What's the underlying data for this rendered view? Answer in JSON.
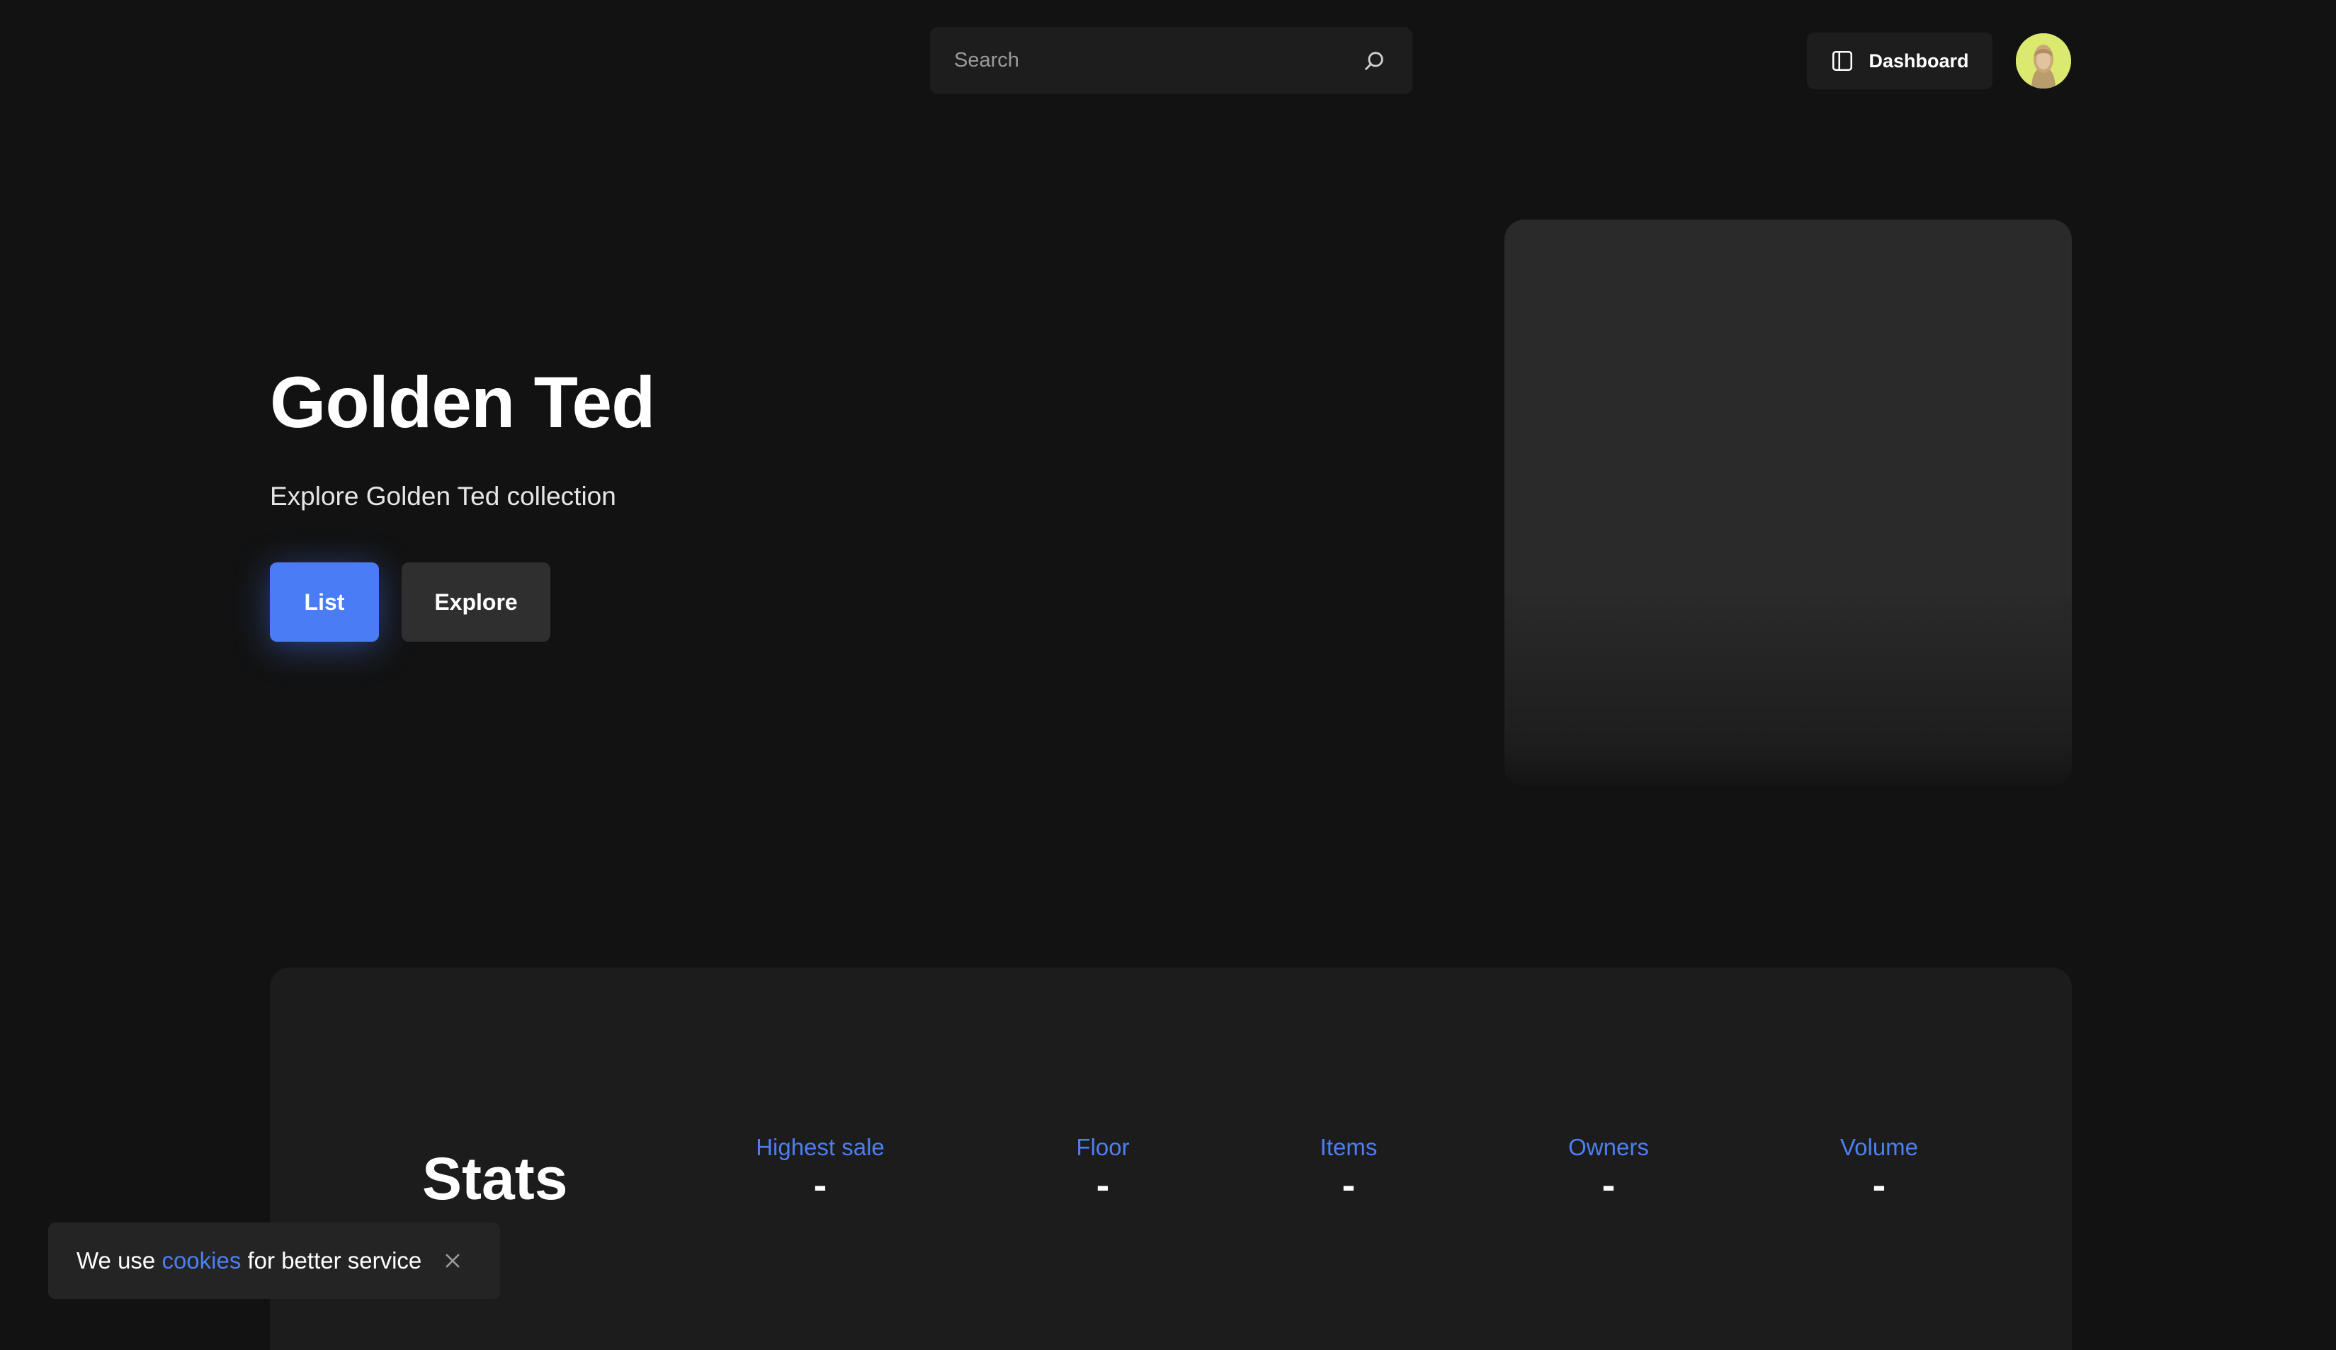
{
  "header": {
    "search_placeholder": "Search",
    "dashboard_label": "Dashboard"
  },
  "hero": {
    "title": "Golden Ted",
    "subtitle": "Explore Golden Ted collection",
    "list_label": "List",
    "explore_label": "Explore"
  },
  "stats": {
    "title": "Stats",
    "items": [
      {
        "label": "Highest sale",
        "value": "-"
      },
      {
        "label": "Floor",
        "value": "-"
      },
      {
        "label": "Items",
        "value": "-"
      },
      {
        "label": "Owners",
        "value": "-"
      },
      {
        "label": "Volume",
        "value": "-"
      }
    ]
  },
  "cookie": {
    "prefix": "We use",
    "link": "cookies",
    "suffix": "for better service"
  },
  "colors": {
    "background": "#121212",
    "accent": "#4a7cf6",
    "surface": "#1c1c1c"
  },
  "icons": [
    "search-icon",
    "sidebar-panel-icon",
    "close-icon"
  ]
}
